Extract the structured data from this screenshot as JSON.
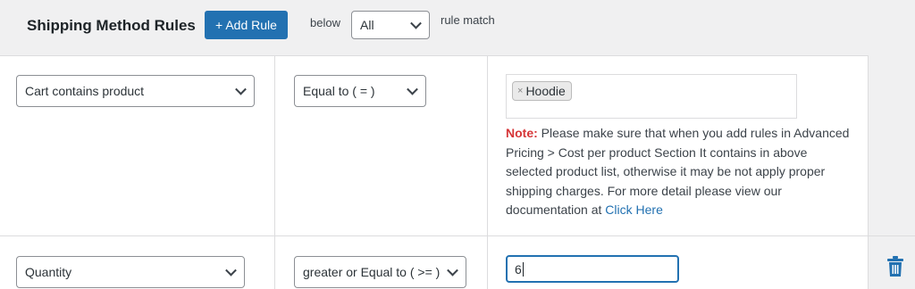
{
  "header": {
    "title": "Shipping Method Rules",
    "add_rule_label": "+ Add Rule",
    "below_label": "below",
    "match_select_value": "All",
    "rule_match_label": "rule match"
  },
  "rows": [
    {
      "field": "Cart contains product",
      "operator": "Equal to ( = )",
      "tags": [
        "Hoodie"
      ],
      "tag_remove": "×",
      "note_label": "Note:",
      "note_text": " Please make sure that when you add rules in Advanced Pricing > Cost per product Section It contains in above selected product list, otherwise it may be not apply proper shipping charges. For more detail please view our documentation at ",
      "note_link": "Click Here"
    },
    {
      "field": "Quantity",
      "operator": "greater or Equal to ( >= )",
      "value": "6"
    }
  ],
  "icons": {
    "select_arrow": "chevron-down-icon",
    "delete": "trash-icon"
  },
  "colors": {
    "accent": "#2271b1",
    "note_label": "#d63638",
    "header_bg": "#f0f0f1"
  }
}
